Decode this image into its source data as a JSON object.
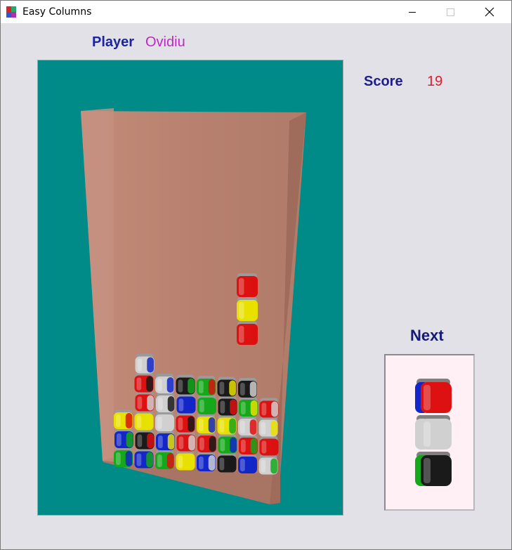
{
  "window": {
    "title": "Easy Columns",
    "icons": {
      "app": "game-app-icon",
      "minimize": "minimize-icon",
      "maximize": "maximize-icon",
      "close": "close-icon"
    }
  },
  "player": {
    "label": "Player",
    "name": "Ovidiu"
  },
  "score": {
    "label": "Score",
    "value": "19"
  },
  "next": {
    "label": "Next",
    "pieces": [
      "red-blue",
      "white",
      "black-green"
    ]
  },
  "colors": {
    "board_background": "#008b89",
    "well": "#b8816f",
    "next_background": "#fef0f4",
    "player_label": "#1c24a0",
    "player_name": "#c026c6",
    "score_value": "#e4192a",
    "block_red": "#dd1111",
    "block_yellow": "#e8e000",
    "block_blue": "#1326c9",
    "block_green": "#15a81a",
    "block_white": "#d0d0d0",
    "block_black": "#1a1a1a"
  },
  "falling_piece": [
    "red",
    "yellow",
    "red"
  ],
  "stack_columns": [
    [
      "green",
      "blue",
      "yellow"
    ],
    [
      "blue",
      "black",
      "yellow",
      "red",
      "red",
      "white"
    ],
    [
      "green",
      "blue",
      "white",
      "white",
      "white"
    ],
    [
      "yellow",
      "red",
      "red",
      "blue",
      "black"
    ],
    [
      "blue",
      "red",
      "yellow",
      "green",
      "green"
    ],
    [
      "black",
      "green",
      "yellow",
      "black",
      "black"
    ],
    [
      "blue",
      "red",
      "white",
      "green",
      "black"
    ],
    [
      "white",
      "red",
      "white",
      "red"
    ]
  ]
}
